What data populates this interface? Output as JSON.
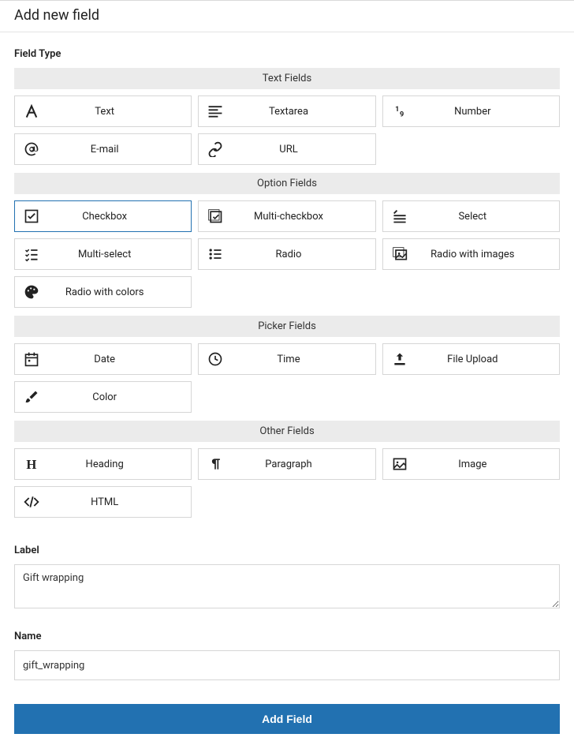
{
  "page_title": "Add new field",
  "field_type_label": "Field Type",
  "groups": [
    {
      "header": "Text Fields",
      "options": [
        {
          "key": "text",
          "label": "Text",
          "icon": "font-icon"
        },
        {
          "key": "textarea",
          "label": "Textarea",
          "icon": "align-left-icon"
        },
        {
          "key": "number",
          "label": "Number",
          "icon": "nineteen-icon"
        },
        {
          "key": "email",
          "label": "E-mail",
          "icon": "at-icon"
        },
        {
          "key": "url",
          "label": "URL",
          "icon": "link-icon"
        }
      ]
    },
    {
      "header": "Option Fields",
      "options": [
        {
          "key": "checkbox",
          "label": "Checkbox",
          "icon": "checkbox-icon",
          "selected": true
        },
        {
          "key": "multi_checkbox",
          "label": "Multi-checkbox",
          "icon": "multi-checkbox-icon"
        },
        {
          "key": "select",
          "label": "Select",
          "icon": "select-icon"
        },
        {
          "key": "multi_select",
          "label": "Multi-select",
          "icon": "list-check-icon"
        },
        {
          "key": "radio",
          "label": "Radio",
          "icon": "list-dots-icon"
        },
        {
          "key": "radio_images",
          "label": "Radio with images",
          "icon": "images-icon"
        },
        {
          "key": "radio_colors",
          "label": "Radio with colors",
          "icon": "palette-icon"
        }
      ]
    },
    {
      "header": "Picker Fields",
      "options": [
        {
          "key": "date",
          "label": "Date",
          "icon": "calendar-icon"
        },
        {
          "key": "time",
          "label": "Time",
          "icon": "clock-icon"
        },
        {
          "key": "file",
          "label": "File Upload",
          "icon": "upload-icon"
        },
        {
          "key": "color",
          "label": "Color",
          "icon": "brush-icon"
        }
      ]
    },
    {
      "header": "Other Fields",
      "options": [
        {
          "key": "heading",
          "label": "Heading",
          "icon": "heading-icon"
        },
        {
          "key": "paragraph",
          "label": "Paragraph",
          "icon": "pilcrow-icon"
        },
        {
          "key": "image",
          "label": "Image",
          "icon": "image-icon"
        },
        {
          "key": "html",
          "label": "HTML",
          "icon": "code-icon"
        }
      ]
    }
  ],
  "label_field": {
    "label": "Label",
    "value": "Gift wrapping"
  },
  "name_field": {
    "label": "Name",
    "value": "gift_wrapping"
  },
  "submit_label": "Add Field",
  "colors": {
    "accent": "#2271b1"
  }
}
